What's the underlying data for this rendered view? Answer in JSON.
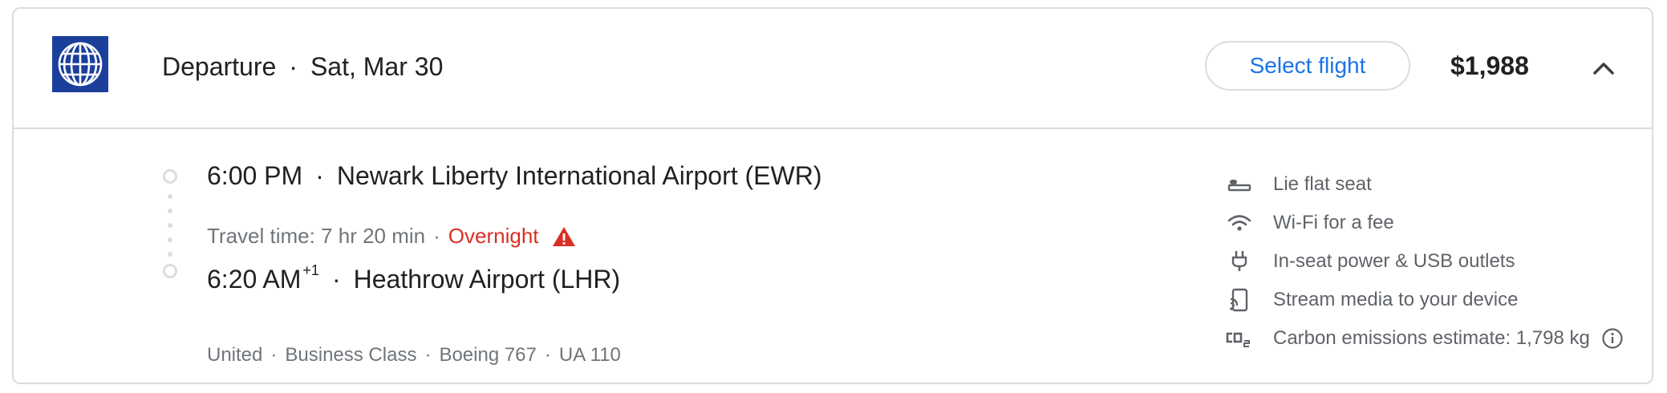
{
  "header": {
    "airline_logo": "united-globe-logo",
    "direction": "Departure",
    "date": "Sat, Mar 30",
    "select_label": "Select flight",
    "price": "$1,988",
    "collapse_icon": "chevron-up-icon"
  },
  "segment": {
    "departure_time": "6:00 PM",
    "departure_airport": "Newark Liberty International Airport (EWR)",
    "travel_time": "Travel time: 7 hr 20 min",
    "overnight": "Overnight",
    "arrival_time": "6:20 AM",
    "arrival_day_offset": "+1",
    "arrival_airport": "Heathrow Airport (LHR)"
  },
  "details": {
    "airline": "United",
    "cabin": "Business Class",
    "aircraft": "Boeing 767",
    "flight_number": "UA 110"
  },
  "amenities": [
    {
      "icon": "lie-flat-seat-icon",
      "label": "Lie flat seat"
    },
    {
      "icon": "wifi-icon",
      "label": "Wi-Fi for a fee"
    },
    {
      "icon": "power-plug-icon",
      "label": "In-seat power & USB outlets"
    },
    {
      "icon": "stream-media-icon",
      "label": "Stream media to your device"
    },
    {
      "icon": "co2-icon",
      "label": "Carbon emissions estimate: 1,798 kg"
    }
  ],
  "colors": {
    "accent_blue": "#1a73e8",
    "warning_red": "#d93025",
    "border": "#dadce0",
    "secondary_text": "#70757a",
    "logo_blue": "#1b3f9b"
  }
}
